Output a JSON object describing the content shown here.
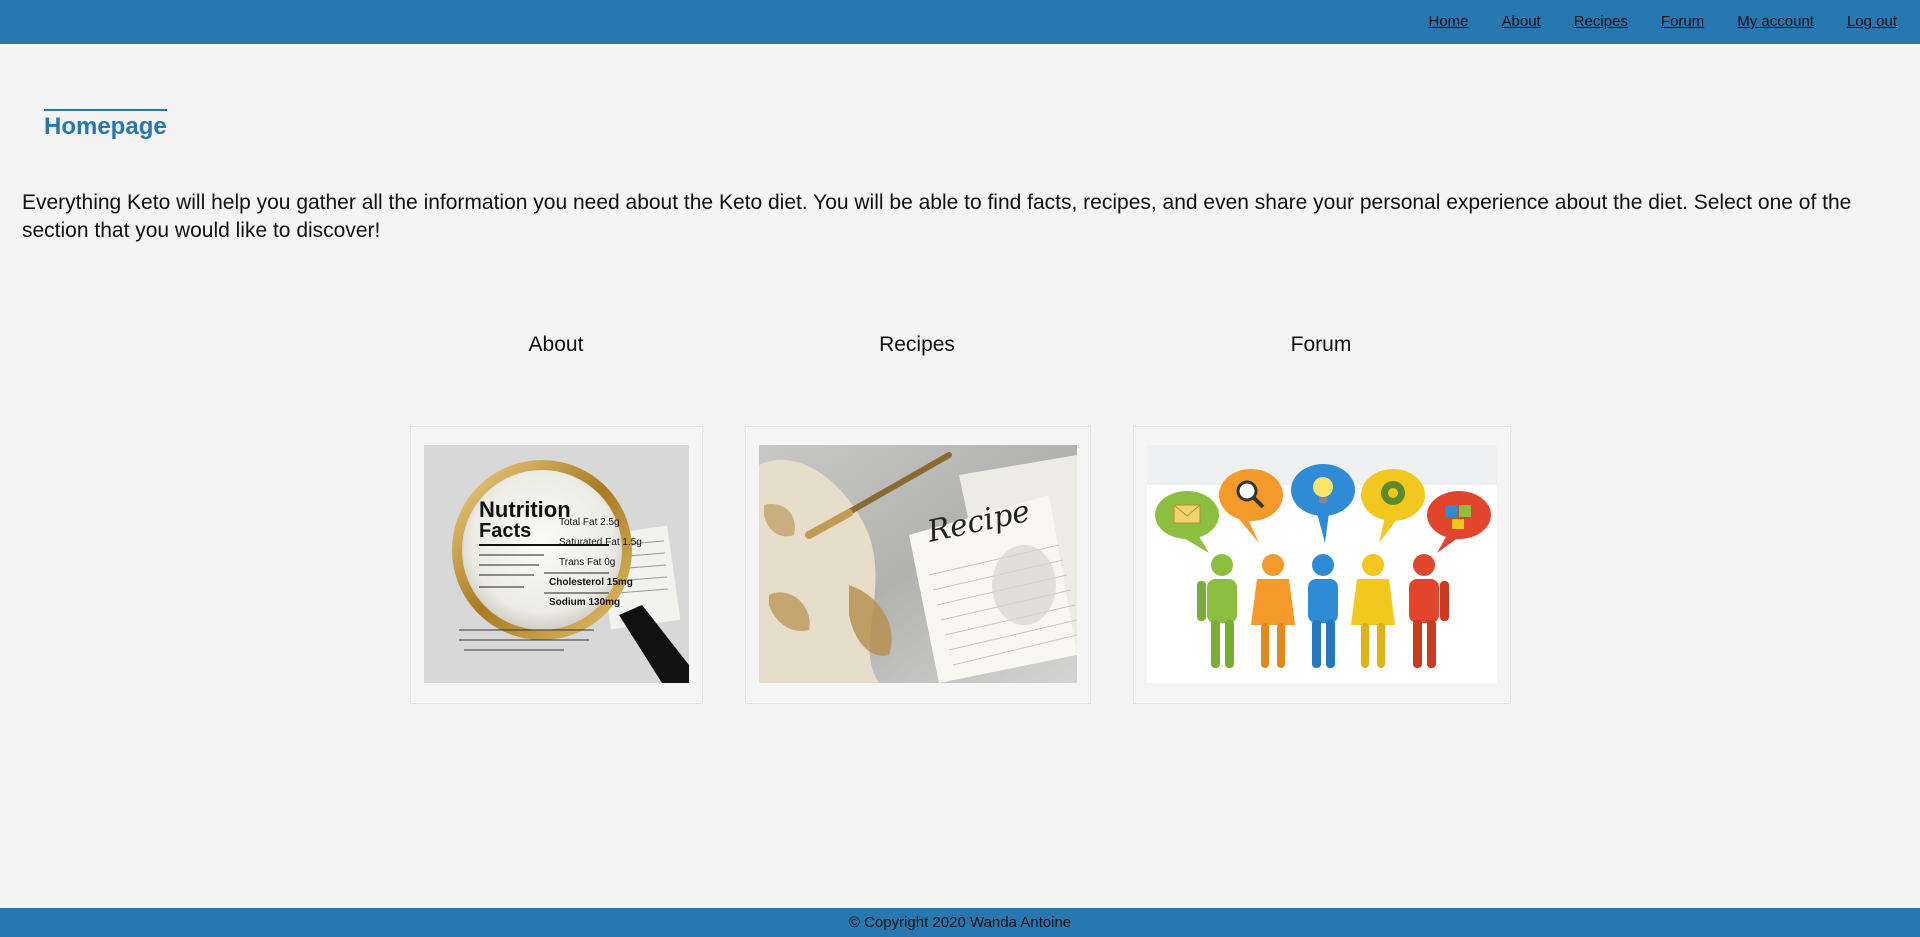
{
  "nav": {
    "items": [
      {
        "label": "Home"
      },
      {
        "label": "About"
      },
      {
        "label": "Recipes"
      },
      {
        "label": "Forum"
      },
      {
        "label": "My account"
      },
      {
        "label": "Log out"
      }
    ]
  },
  "page": {
    "title": "Homepage",
    "intro": "Everything Keto will help you gather all the information you need about the Keto diet. You will be able to find facts, recipes, and even share your personal experience about the diet. Select one of the section that you would like to discover!"
  },
  "sections": [
    {
      "label": "About",
      "image_icon": "magnifier-nutrition-facts-image"
    },
    {
      "label": "Recipes",
      "image_icon": "recipe-card-image"
    },
    {
      "label": "Forum",
      "image_icon": "people-speech-bubbles-image"
    }
  ],
  "nutrition_image": {
    "title": "Nutrition",
    "subtitle": "Facts",
    "rows": [
      "Total Fat 2.5g",
      "Saturated Fat 1.5g",
      "Trans Fat 0g",
      "Cholesterol 15mg",
      "Sodium 130mg"
    ]
  },
  "recipe_image": {
    "script": "Recipe"
  },
  "footer": {
    "text": "© Copyright 2020 Wanda Antoine"
  },
  "colors": {
    "accent": "#2778b1",
    "background": "#f4f4f4"
  }
}
